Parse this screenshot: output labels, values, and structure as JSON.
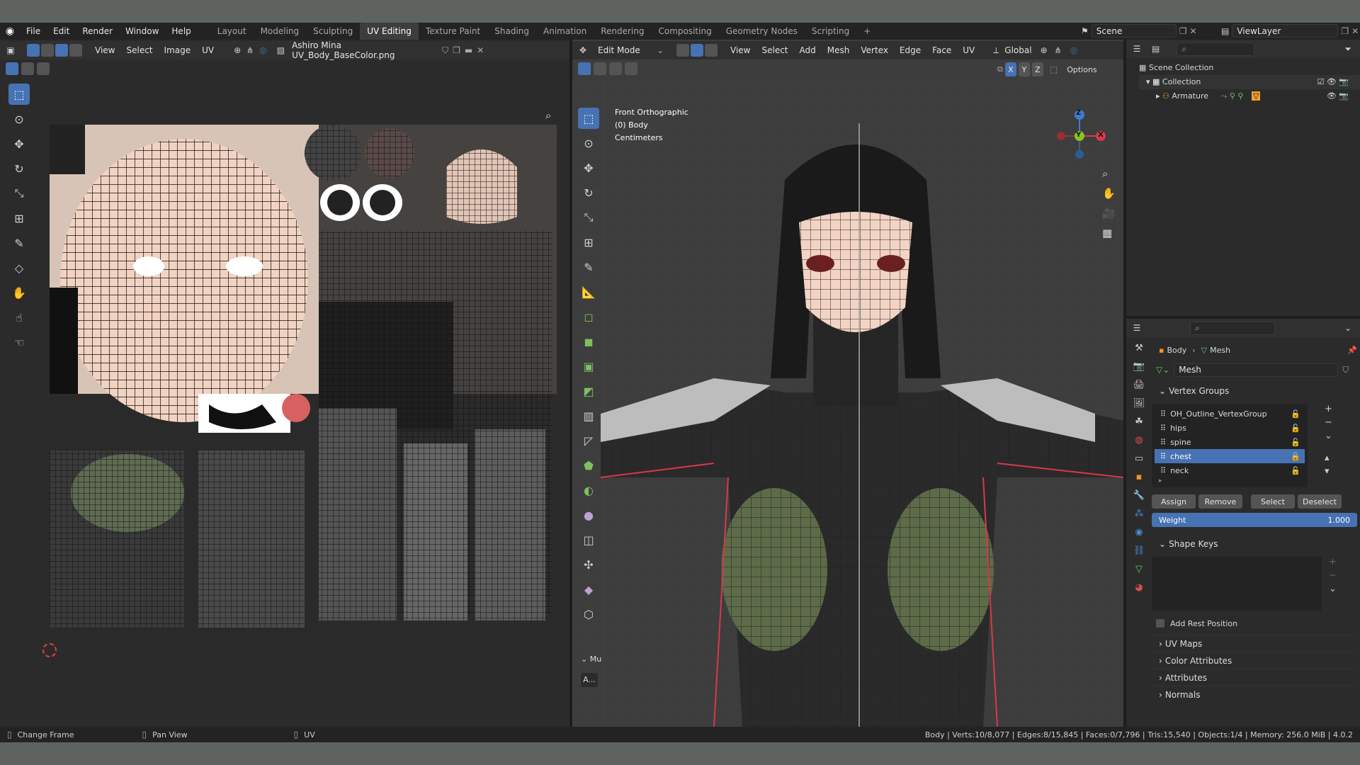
{
  "topbar": {
    "menus": [
      "File",
      "Edit",
      "Render",
      "Window",
      "Help"
    ],
    "workspaces": [
      "Layout",
      "Modeling",
      "Sculpting",
      "UV Editing",
      "Texture Paint",
      "Shading",
      "Animation",
      "Rendering",
      "Compositing",
      "Geometry Nodes",
      "Scripting",
      "+"
    ],
    "active_workspace": "UV Editing",
    "scene": "Scene",
    "view_layer": "ViewLayer"
  },
  "uv_editor": {
    "menus": [
      "View",
      "Select",
      "Image",
      "UV"
    ],
    "image_name": "Ashiro Mina UV_Body_BaseColor.png"
  },
  "viewport": {
    "mode": "Edit Mode",
    "menus": [
      "View",
      "Select",
      "Add",
      "Mesh",
      "Vertex",
      "Edge",
      "Face",
      "UV"
    ],
    "orientation": "Global",
    "axes": [
      "X",
      "Y",
      "Z"
    ],
    "options": "Options",
    "overlay_title": "Front Orthographic",
    "overlay_object": "(0) Body",
    "overlay_units": "Centimeters",
    "gizmo_z": "Z",
    "gizmo_y": "Y",
    "gizmo_x": "X",
    "redo_panel": "Mu",
    "redo_btn": "A..."
  },
  "outliner": {
    "root": "Scene Collection",
    "collection": "Collection",
    "armature": "Armature"
  },
  "properties": {
    "breadcrumb_object": "Body",
    "breadcrumb_mesh": "Mesh",
    "mesh_name": "Mesh",
    "vertex_groups_title": "Vertex Groups",
    "vertex_groups": [
      "OH_Outline_VertexGroup",
      "hips",
      "spine",
      "chest",
      "neck"
    ],
    "selected_group": "chest",
    "buttons": [
      "Assign",
      "Remove",
      "Select",
      "Deselect"
    ],
    "weight_label": "Weight",
    "weight_value": "1.000",
    "shape_keys_title": "Shape Keys",
    "add_rest_position": "Add Rest Position",
    "sections": [
      "UV Maps",
      "Color Attributes",
      "Attributes",
      "Normals"
    ]
  },
  "status": {
    "left1": "Change Frame",
    "left2": "Pan View",
    "left3": "UV",
    "right": "Body | Verts:10/8,077 | Edges:8/15,845 | Faces:0/7,796 | Tris:15,540 | Objects:1/4 | Memory: 256.0 MiB | 4.0.2"
  },
  "colors": {
    "accent": "#4772b3",
    "header": "#303030",
    "viewport_bg": "#3d3d3d",
    "panel_bg": "#2b2b2b",
    "red_axis": "#d63a47",
    "green_axis": "#8bc21c",
    "blue_axis": "#3b7ed4"
  }
}
